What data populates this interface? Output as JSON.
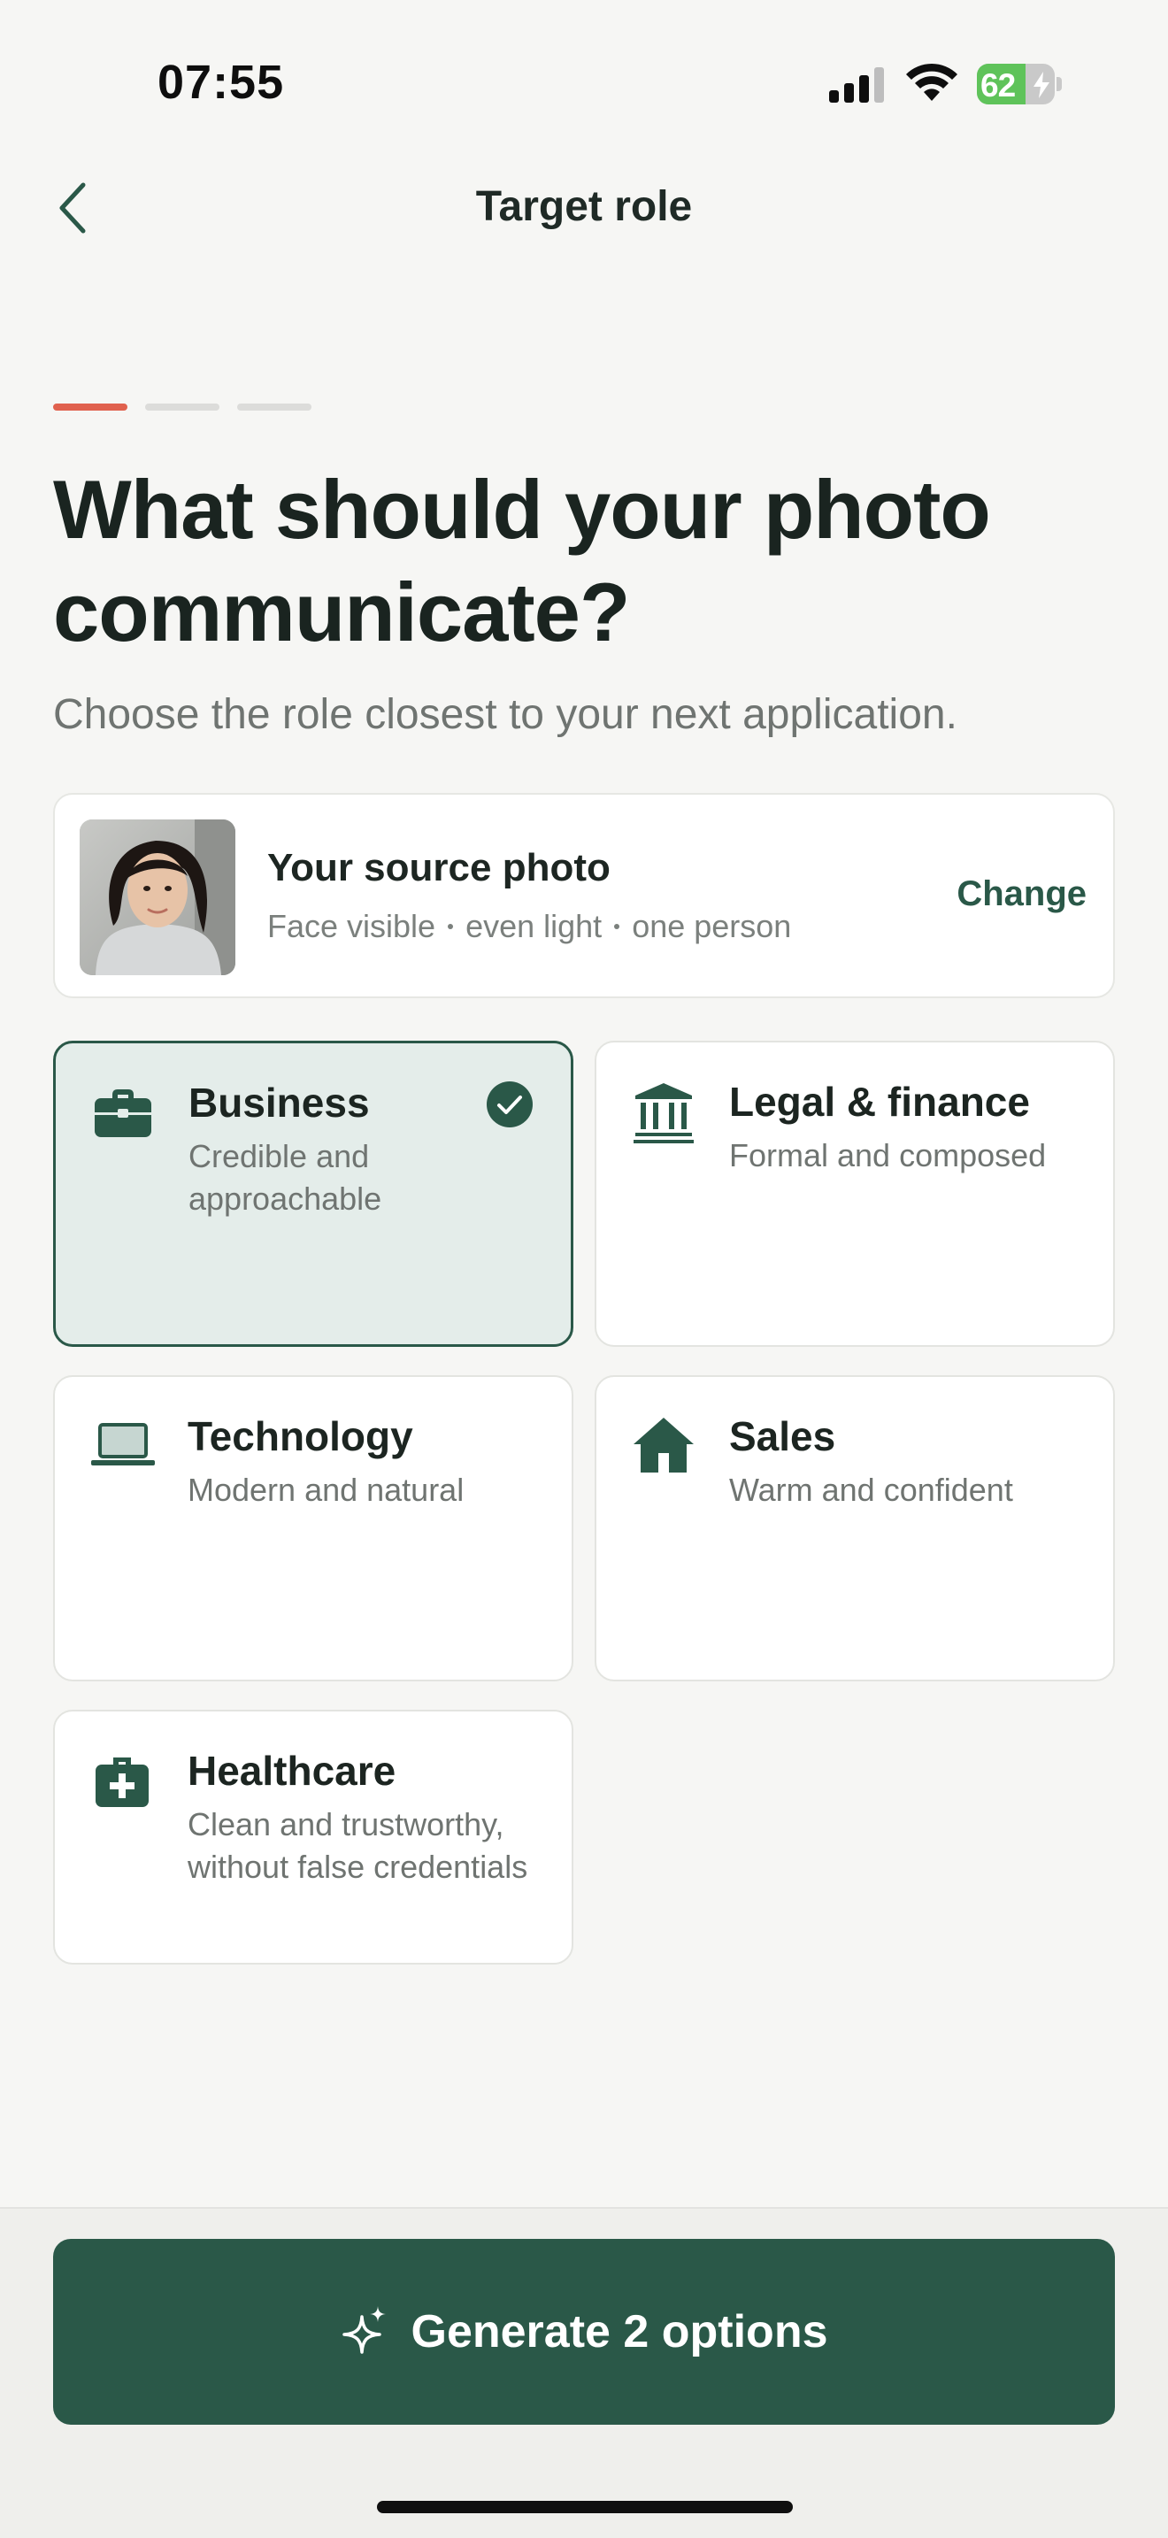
{
  "status_bar": {
    "time": "07:55",
    "battery_percent": "62",
    "battery_level": 0.62,
    "icons": [
      "signal-icon",
      "wifi-icon",
      "battery-icon",
      "charging-bolt-icon"
    ]
  },
  "nav": {
    "back_icon": "chevron-left-icon",
    "title": "Target role"
  },
  "progress": {
    "total_steps": 3,
    "current_step": 1
  },
  "headline": "What should your photo communicate?",
  "subheadline": "Choose the role closest to your next application.",
  "source_photo": {
    "title": "Your source photo",
    "meta": [
      "Face visible",
      "even light",
      "one person"
    ],
    "change_label": "Change"
  },
  "roles": [
    {
      "title": "Business",
      "description": "Credible and approachable",
      "icon": "briefcase-icon",
      "selected": true
    },
    {
      "title": "Legal & finance",
      "description": "Formal and composed",
      "icon": "bank-columns-icon",
      "selected": false
    },
    {
      "title": "Technology",
      "description": "Modern and natural",
      "icon": "laptop-icon",
      "selected": false
    },
    {
      "title": "Sales",
      "description": "Warm and confident",
      "icon": "house-icon",
      "selected": false
    },
    {
      "title": "Healthcare",
      "description": "Clean and trustworthy, without false credentials",
      "icon": "medical-kit-icon",
      "selected": false
    }
  ],
  "generate_button": {
    "label": "Generate 2 options",
    "icon": "sparkle-icon"
  },
  "colors": {
    "accent": "#2a5848",
    "progress_active": "#e0614e",
    "selected_card_bg": "#e4edea",
    "background": "#f6f6f4"
  }
}
